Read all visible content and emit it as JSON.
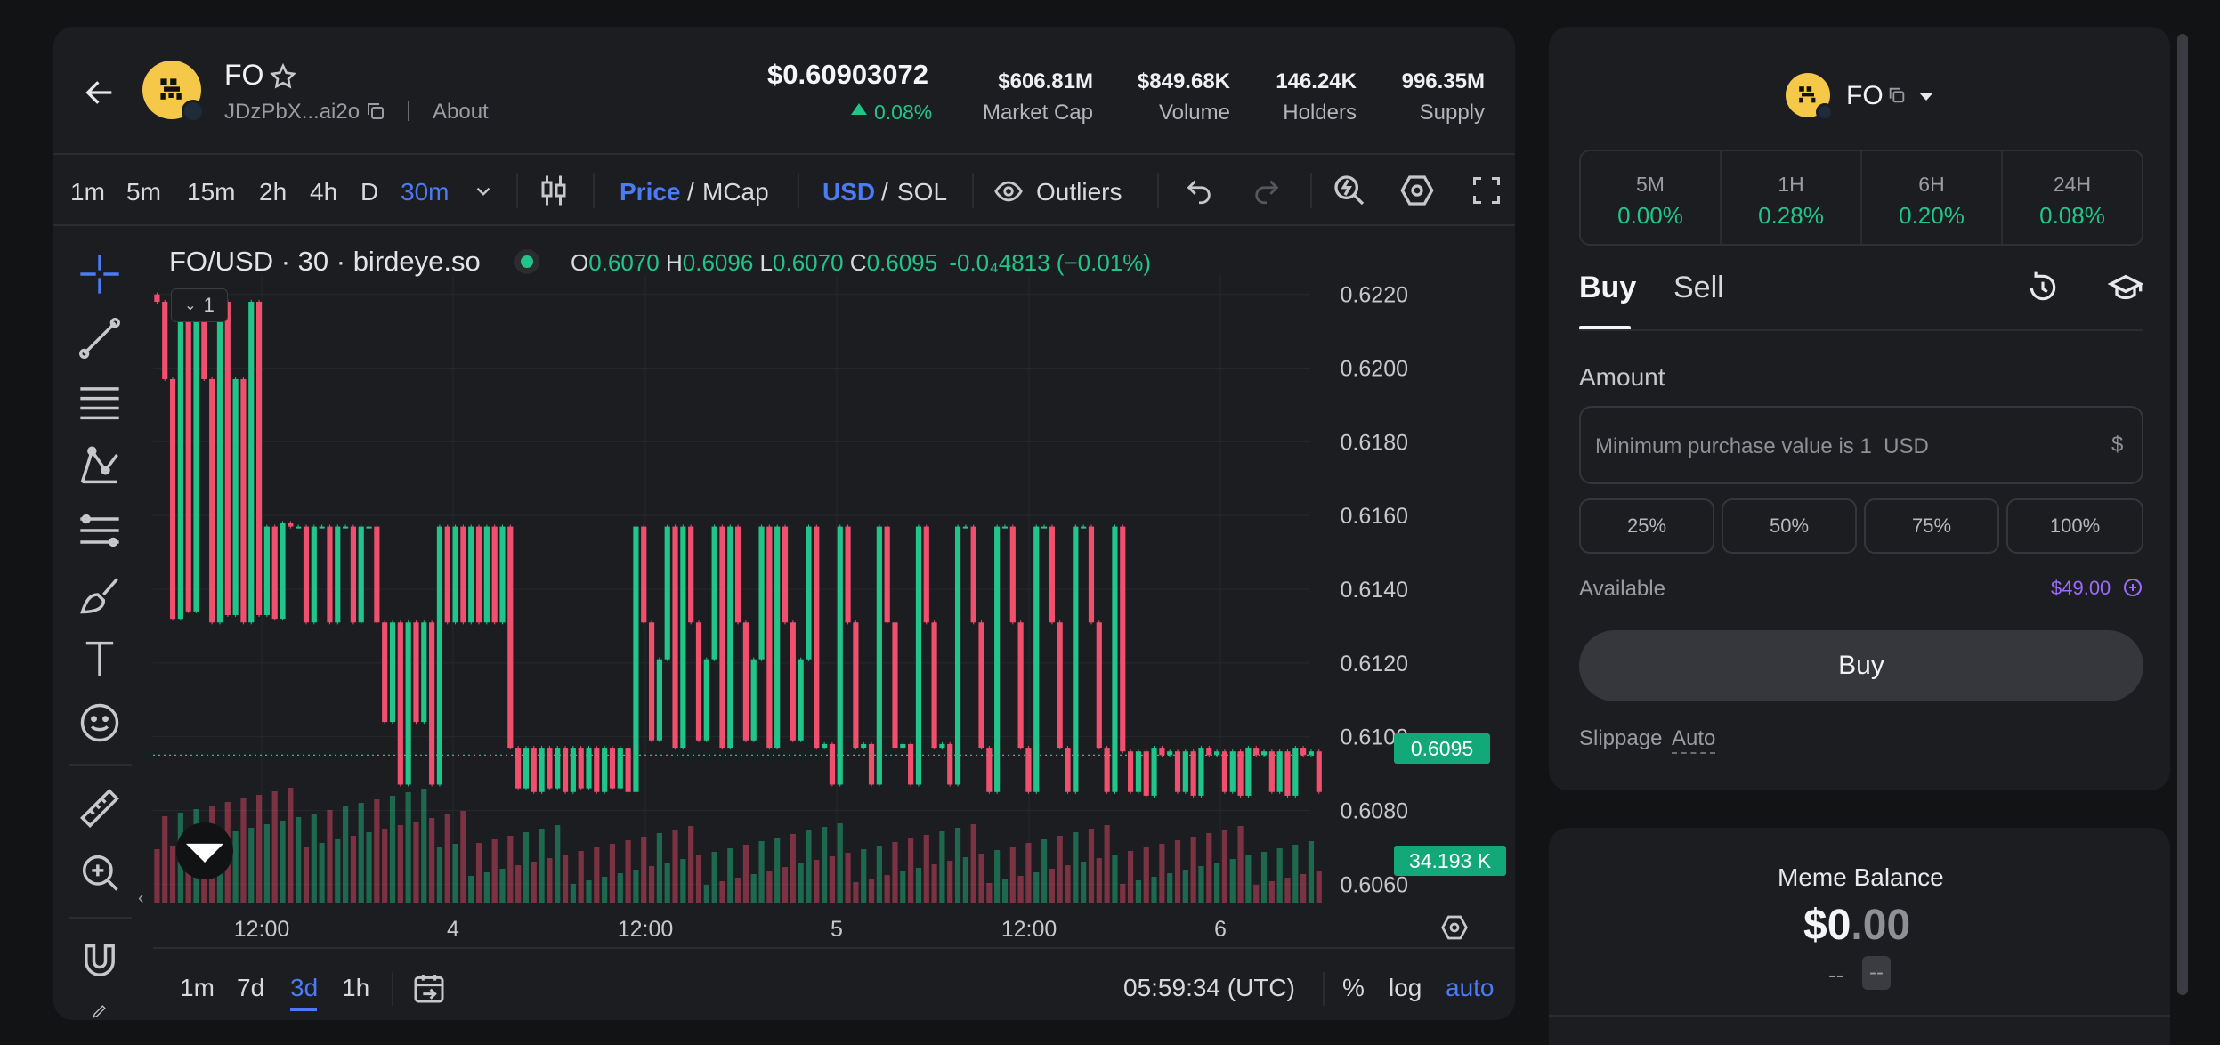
{
  "token": {
    "symbol": "FO",
    "address": "JDzPbX...ai2o",
    "about_label": "About",
    "price": "$0.60903072",
    "change": "0.08%",
    "stats": [
      {
        "value": "$606.81M",
        "label": "Market Cap"
      },
      {
        "value": "$849.68K",
        "label": "Volume"
      },
      {
        "value": "146.24K",
        "label": "Holders"
      },
      {
        "value": "996.35M",
        "label": "Supply"
      }
    ]
  },
  "toolbar": {
    "timeframes": [
      "1m",
      "5m",
      "15m",
      "2h",
      "4h",
      "D",
      "30m"
    ],
    "active_timeframe": "30m",
    "price_label": "Price",
    "mcap_label": "MCap",
    "sep": "/",
    "usd_label": "USD",
    "sol_label": "SOL",
    "outliers_label": "Outliers"
  },
  "legend": {
    "pair": "FO/USD · 30 · birdeye.so",
    "o_label": "O",
    "o": "0.6070",
    "h_label": "H",
    "h": "0.6096",
    "l_label": "L",
    "l": "0.6070",
    "c_label": "C",
    "c": "0.6095",
    "chg": "-0.0₄4813 (−0.01%)",
    "collapse_count": "1"
  },
  "chart_data": {
    "type": "candlestick",
    "title": "FO/USD · 30 · birdeye.so",
    "y_ticks": [
      "0.6220",
      "0.6200",
      "0.6180",
      "0.6160",
      "0.6140",
      "0.6120",
      "0.6100",
      "0.6080",
      "0.6060"
    ],
    "x_ticks": [
      "12:00",
      "4",
      "12:00",
      "5",
      "12:00",
      "6"
    ],
    "ylim": [
      0.6055,
      0.6225
    ],
    "last_price": 0.6095,
    "last_price_label": "0.6095",
    "volume_label": "34.193 K",
    "segments": [
      {
        "from": 0,
        "to": 5,
        "levels": [
          0.6218,
          0.6197,
          0.6132,
          0.6215,
          0.6134
        ]
      },
      {
        "from": 6,
        "to": 13,
        "levels": [
          0.6197,
          0.6131,
          0.6218,
          0.6133
        ]
      },
      {
        "from": 14,
        "to": 17,
        "levels": [
          0.6157,
          0.6132,
          0.6158
        ]
      },
      {
        "from": 18,
        "to": 27,
        "levels": [
          0.6157,
          0.6131,
          0.6157
        ]
      },
      {
        "from": 28,
        "to": 35,
        "levels": [
          0.6131,
          0.6104,
          0.6131,
          0.6087
        ]
      },
      {
        "from": 36,
        "to": 44,
        "levels": [
          0.6157,
          0.6131,
          0.6157,
          0.6131
        ]
      },
      {
        "from": 45,
        "to": 60,
        "levels": [
          0.6097,
          0.6086,
          0.6097,
          0.6085
        ]
      },
      {
        "from": 61,
        "to": 84,
        "levels": [
          0.6157,
          0.6131,
          0.6099,
          0.6121,
          0.6157,
          0.6097
        ]
      },
      {
        "from": 85,
        "to": 102,
        "levels": [
          0.6098,
          0.6087,
          0.6157,
          0.6131,
          0.6097
        ]
      },
      {
        "from": 103,
        "to": 122,
        "levels": [
          0.6157,
          0.6131,
          0.6097,
          0.6085,
          0.6157
        ]
      },
      {
        "from": 123,
        "to": 148,
        "levels": [
          0.6096,
          0.6085,
          0.6096,
          0.6084,
          0.6097,
          0.6095
        ]
      }
    ]
  },
  "bottom_bar": {
    "ranges": [
      "1m",
      "7d",
      "3d",
      "1h"
    ],
    "active_range": "3d",
    "time": "05:59:34 (UTC)",
    "percent": "%",
    "log": "log",
    "auto": "auto"
  },
  "trade": {
    "symbol": "FO",
    "periods": [
      {
        "label": "5M",
        "value": "0.00%"
      },
      {
        "label": "1H",
        "value": "0.28%"
      },
      {
        "label": "6H",
        "value": "0.20%"
      },
      {
        "label": "24H",
        "value": "0.08%"
      }
    ],
    "buy_tab": "Buy",
    "sell_tab": "Sell",
    "amount_label": "Amount",
    "amount_placeholder": "Minimum purchase value is 1  USD",
    "currency_symbol": "$",
    "pcts": [
      "25%",
      "50%",
      "75%",
      "100%"
    ],
    "available_label": "Available",
    "available_value": "$49.00",
    "buy_button": "Buy",
    "slippage_label": "Slippage",
    "slippage_value": "Auto"
  },
  "balance": {
    "title": "Meme Balance",
    "dollar": "$",
    "int": "0",
    "dec": ".00",
    "sub1": "--",
    "sub2": "--"
  },
  "colors": {
    "up": "#21c58a",
    "down": "#f0506e",
    "accent": "#4b7bf5",
    "purple": "#9a6cf7"
  }
}
